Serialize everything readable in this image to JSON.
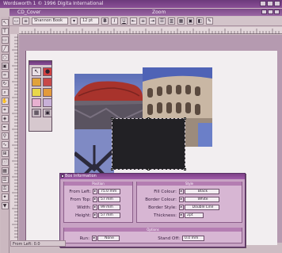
{
  "app": {
    "title": "Wordsworth 1  © 1996 Digita International"
  },
  "document": {
    "window_title": "CD_Cover",
    "zoom_label": "Zoom"
  },
  "toolbar": {
    "font_name": "Shannon Book",
    "font_size": "12 pt"
  },
  "palette": {
    "cells": [
      {
        "icon": "arrow-icon",
        "glyph": "↖",
        "color": "#e8dfe4"
      },
      {
        "icon": "paint-icon",
        "glyph": "●",
        "color": "#d24040"
      },
      {
        "icon": "fill-icon",
        "glyph": "",
        "color": "#e0a23a"
      },
      {
        "icon": "swatch-red-icon",
        "glyph": "",
        "color": "#c84848"
      },
      {
        "icon": "swatch-yellow-icon",
        "glyph": "",
        "color": "#e8d84a"
      },
      {
        "icon": "swatch-orange-icon",
        "glyph": "",
        "color": "#e29a3c"
      },
      {
        "icon": "swatch-pink-icon",
        "glyph": "",
        "color": "#e8b0d0"
      },
      {
        "icon": "swatch-lilac-icon",
        "glyph": "",
        "color": "#c8b0d8"
      },
      {
        "icon": "grid-icon",
        "glyph": "▦",
        "color": "#c9bcc4"
      },
      {
        "icon": "frame-icon",
        "glyph": "▣",
        "color": "#c9bcc4"
      }
    ]
  },
  "dialog": {
    "title": "Box Information",
    "position_group": "Position",
    "style_group": "Style",
    "options_group": "Options",
    "fields": {
      "from_left_label": "From Left:",
      "from_left_value": "75.0 mm",
      "from_top_label": "From Top:",
      "from_top_value": "57 mm",
      "width_label": "Width:",
      "width_value": "99 mm",
      "height_label": "Height:",
      "height_value": "57 mm",
      "fill_colour_label": "Fill Colour:",
      "fill_colour_value": "Black",
      "border_colour_label": "Border Colour:",
      "border_colour_value": "White",
      "border_style_label": "Border Style:",
      "border_style_value": "Double Line",
      "thickness_label": "Thickness:",
      "thickness_value": "2pt",
      "run_label": "Run:",
      "run_value": "None",
      "stand_off_label": "Stand Off:",
      "stand_off_value": "0.0 mm"
    }
  },
  "status": {
    "text": "From Left: 0.0"
  },
  "colors": {
    "accent": "#7c3f86",
    "dialog_bg": "#c8a3c4",
    "page_bg": "#f2eef0",
    "pasteboard": "#b59ab0"
  }
}
